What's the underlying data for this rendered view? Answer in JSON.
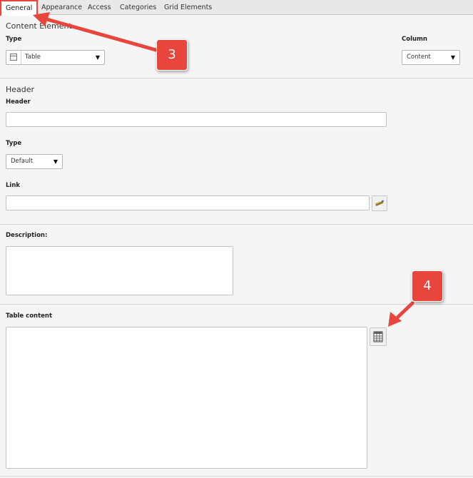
{
  "tabs": [
    {
      "label": "General",
      "active": true
    },
    {
      "label": "Appearance",
      "active": false
    },
    {
      "label": "Access",
      "active": false
    },
    {
      "label": "Categories",
      "active": false
    },
    {
      "label": "Grid Elements",
      "active": false
    }
  ],
  "content_element": {
    "section_title": "Content Element",
    "type_label": "Type",
    "type_value": "Table",
    "column_label": "Column",
    "column_value": "Content"
  },
  "header_section": {
    "section_title": "Header",
    "header_label": "Header",
    "header_value": "",
    "type_label": "Type",
    "type_value": "Default",
    "link_label": "Link",
    "link_value": ""
  },
  "description": {
    "label": "Description:",
    "value": ""
  },
  "table_content": {
    "label": "Table content",
    "value": ""
  },
  "callouts": {
    "step3": "3",
    "step4": "4"
  },
  "icons": {
    "type": "table-icon",
    "link": "link-wizard-icon",
    "table_wizard": "table-wizard-icon",
    "chevron": "chevron-down-icon"
  },
  "colors": {
    "accent": "#e8453c",
    "background": "#f5f5f5",
    "tabbar": "#e8e8e8"
  }
}
